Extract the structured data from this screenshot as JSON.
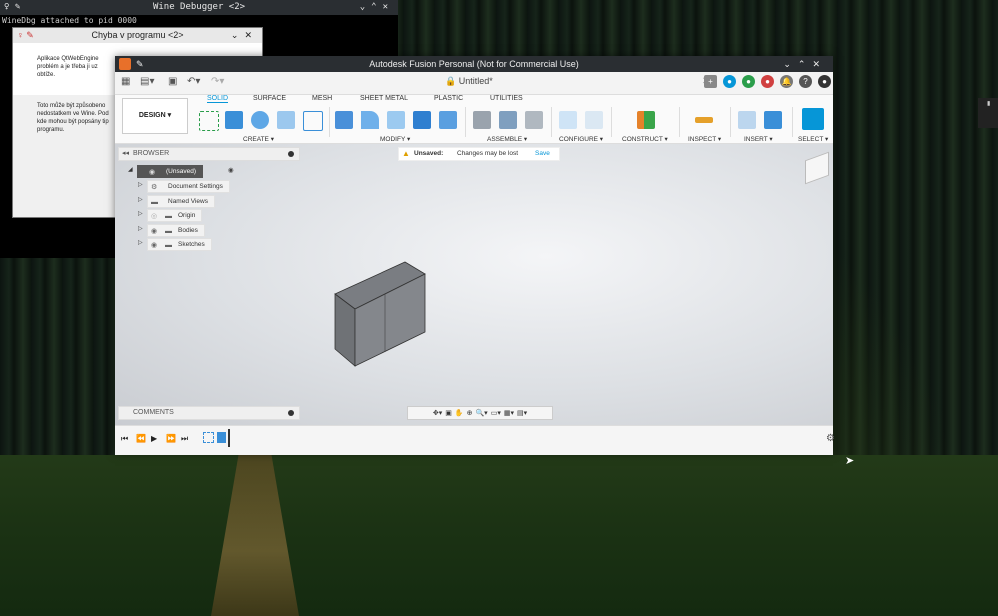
{
  "winedbg": {
    "title": "Wine Debugger <2>",
    "line": "WineDbg attached to pid 0000"
  },
  "error_dialog": {
    "title": "Chyba v programu <2>",
    "text1a": "Aplikace QtWebEngine",
    "text1b": "problém a je třeba ji uz",
    "text1c": "obtíže.",
    "text2a": "Toto může být způsobeno",
    "text2b": "nedostatkem ve Wine. Pod",
    "text2c": "kde mohou být popsány tip",
    "text2d": "programu."
  },
  "fusion": {
    "window_title": "Autodesk Fusion Personal (Not for Commercial Use)",
    "doc_title": "Untitled*",
    "design_label": "DESIGN",
    "tabs": [
      "SOLID",
      "SURFACE",
      "MESH",
      "SHEET METAL",
      "PLASTIC",
      "UTILITIES"
    ],
    "groups": [
      "CREATE",
      "MODIFY",
      "ASSEMBLE",
      "CONFIGURE",
      "CONSTRUCT",
      "INSPECT",
      "INSERT",
      "SELECT"
    ],
    "browser_label": "BROWSER",
    "comments_label": "COMMENTS",
    "tree": {
      "root": "(Unsaved)",
      "items": [
        "Document Settings",
        "Named Views",
        "Origin",
        "Bodies",
        "Sketches"
      ]
    },
    "unsaved": {
      "label": "Unsaved:",
      "message": "Changes may be lost",
      "save": "Save"
    },
    "accent_color": "#0696d7"
  }
}
